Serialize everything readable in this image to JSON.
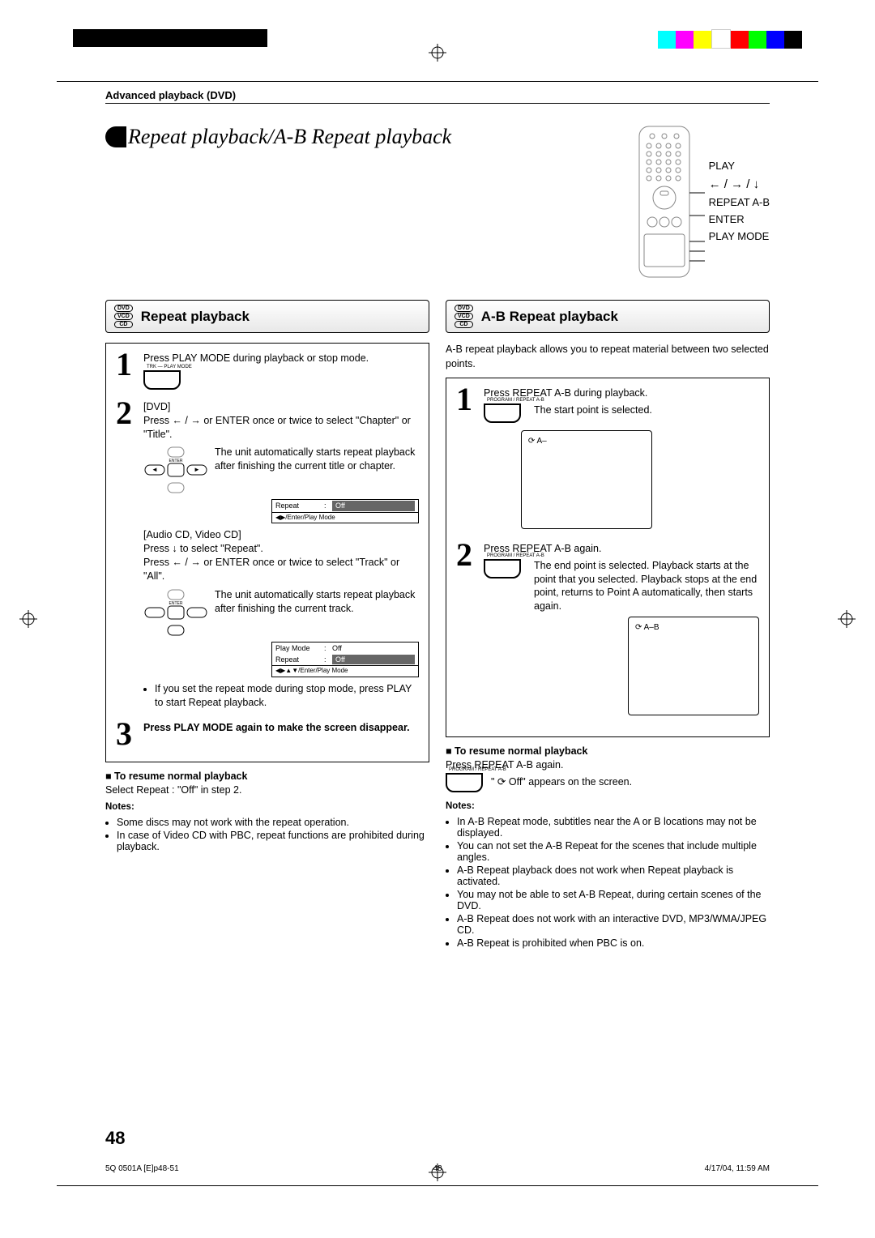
{
  "breadcrumb": "Advanced playback (DVD)",
  "page_title": "Repeat playback/A-B Repeat playback",
  "remote_labels": {
    "play": "PLAY",
    "arrows": "← / → / ↓",
    "repeat_ab": "REPEAT A-B",
    "enter": "ENTER",
    "play_mode": "PLAY MODE"
  },
  "disc_badge": {
    "dvd": "DVD",
    "vcd": "VCD",
    "cd": "CD"
  },
  "left": {
    "heading": "Repeat playback",
    "step1_bold": "Press PLAY MODE during playback or stop mode.",
    "chiclet1": "TRK —\nPLAY MODE",
    "step2_head": "[DVD]",
    "step2_bold": "Press ← / → or ENTER once or twice to select \"Chapter\" or \"Title\".",
    "step2_desc": "The unit automatically starts repeat playback after finishing the current title or chapter.",
    "osd1": {
      "repeat": "Repeat",
      "off": "Off",
      "foot": "◀▶/Enter/Play Mode"
    },
    "cd_head": "[Audio CD, Video CD]",
    "cd_line1": "Press ↓ to select \"Repeat\".",
    "cd_line2": "Press ← / → or ENTER once or twice to select \"Track\" or \"All\".",
    "cd_desc": "The unit automatically starts repeat playback after finishing the current track.",
    "osd2": {
      "playmode": "Play Mode",
      "repeat": "Repeat",
      "off": "Off",
      "foot": "◀▶▲▼/Enter/Play Mode"
    },
    "bullet1": "If you set the repeat mode during stop mode, press PLAY to start Repeat playback.",
    "step3_bold": "Press PLAY MODE again to make the screen disappear.",
    "resume_h": "To resume normal playback",
    "resume_t": "Select Repeat : \"Off\" in step 2.",
    "notes_h": "Notes:",
    "note1": "Some discs may not work with the repeat operation.",
    "note2": "In case of Video CD with PBC, repeat functions are prohibited during playback."
  },
  "right": {
    "heading": "A-B Repeat playback",
    "intro": "A-B repeat playback allows you to repeat material between two selected points.",
    "step1_bold": "Press REPEAT A-B during playback.",
    "step1_desc": "The start point is selected.",
    "chiclet": "PROGRAM /\nREPEAT A-B",
    "tv1_tag": "⟳ A–",
    "step2_bold": "Press REPEAT A-B again.",
    "step2_desc": "The end point is selected. Playback starts at the point that you selected. Playback stops at the end point, returns to Point A automatically, then starts again.",
    "tv2_tag": "⟳ A–B",
    "resume_h": "To resume normal playback",
    "resume_line1": "Press REPEAT A-B again.",
    "resume_line2": "\" ⟳ Off\" appears on the screen.",
    "notes_h": "Notes:",
    "note1": "In A-B Repeat mode, subtitles near the A or B locations may not be displayed.",
    "note2": "You can not set the A-B Repeat for the scenes that include multiple angles.",
    "note3": "A-B Repeat playback does not work when Repeat playback is activated.",
    "note4": "You may not be able to set A-B Repeat, during certain scenes of the DVD.",
    "note5": "A-B Repeat does not work with an interactive DVD, MP3/WMA/JPEG CD.",
    "note6": "A-B Repeat is prohibited when PBC is on."
  },
  "page_number": "48",
  "footer": {
    "left": "5Q 0501A [E]p48-51",
    "mid": "48",
    "right": "4/17/04, 11:59 AM"
  }
}
